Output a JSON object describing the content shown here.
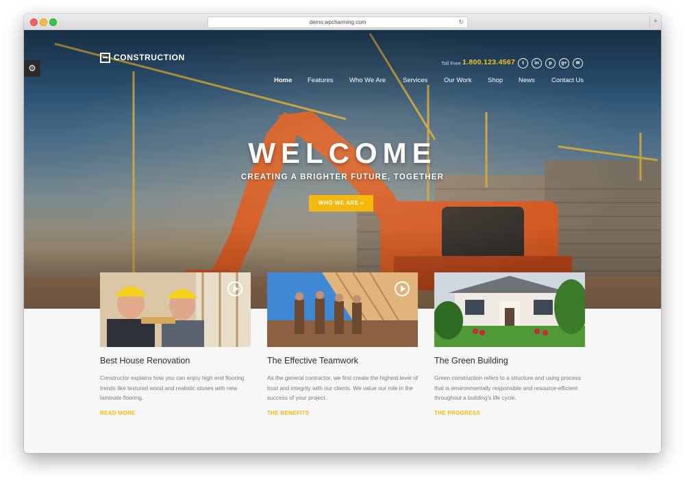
{
  "browser": {
    "url": "demo.wpcharming.com",
    "reload_icon": "reload-icon",
    "new_tab": "+"
  },
  "site": {
    "logo_text": "CONSTRUCTION",
    "toll_free_label": "Toll Free",
    "phone": "1.800.123.4567",
    "social": [
      {
        "name": "twitter-icon",
        "glyph": "t"
      },
      {
        "name": "linkedin-icon",
        "glyph": "in"
      },
      {
        "name": "pinterest-icon",
        "glyph": "p"
      },
      {
        "name": "google-plus-icon",
        "glyph": "g+"
      },
      {
        "name": "email-icon",
        "glyph": "✉"
      }
    ],
    "nav": [
      "Home",
      "Features",
      "Who We Are",
      "Services",
      "Our Work",
      "Shop",
      "News",
      "Contact Us"
    ],
    "active_nav": "Home"
  },
  "hero": {
    "title": "WELCOME",
    "tagline": "CREATING A BRIGHTER FUTURE, TOGETHER",
    "cta": "WHO WE ARE »"
  },
  "settings": {
    "icon": "gear-icon",
    "glyph": "⚙"
  },
  "cards": [
    {
      "title": "Best House Renovation",
      "text": "Constructor explains how you can enjoy high end flooring trends like textured wood and realistic stones with new laminate flooring.",
      "link": "READ MORE",
      "video": true
    },
    {
      "title": "The Effective Teamwork",
      "text": "As the general contractor, we first create the highest level of trust and integrity with our clients. We value our role in the success of your project.",
      "link": "THE BENEFITS",
      "video": true
    },
    {
      "title": "The Green Building",
      "text": "Green construction refers to a structure and using process that is environmentally responsible and resource-efficient throughout a building's life cycle.",
      "link": "THE PROGRESS",
      "video": false
    }
  ],
  "colors": {
    "accent": "#f5b80c",
    "text_dark": "#2a2a2a",
    "text_muted": "#7a7a7a"
  }
}
